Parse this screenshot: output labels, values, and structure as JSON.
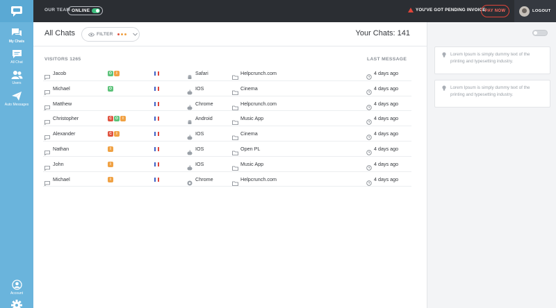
{
  "topbar": {
    "team_label": "OUR TEAM",
    "status": "ONLINE",
    "warning": "YOU'VE GOT PENDING INVOICE",
    "pay_now": "PAY NOW",
    "logout": "LOGOUT",
    "colors": {
      "bg": "#2b2e33",
      "accent": "#e0453a",
      "online": "#3fbf7f"
    }
  },
  "sidebar": {
    "color": "#6ab4dc",
    "items": [
      {
        "label": "My Chats",
        "icon": "chats-icon",
        "active": true
      },
      {
        "label": "All Chat",
        "icon": "chat-bubble-icon",
        "active": false
      },
      {
        "label": "Users",
        "icon": "users-icon",
        "active": false
      },
      {
        "label": "Auto Messages",
        "icon": "paper-plane-icon",
        "active": false
      }
    ],
    "bottom": [
      {
        "label": "Account",
        "icon": "account-icon"
      },
      {
        "label": "",
        "icon": "gear-icon"
      }
    ]
  },
  "main": {
    "title": "All Chats",
    "filter_label": "FILTER",
    "your_chats": "Your Chats: 141",
    "col_visitors": "VISITORS 1265",
    "col_last_message": "LAST MESSAGE"
  },
  "badge_colors": {
    "O": "#5cc279",
    "I": "#f0a143",
    "C": "#e0533f"
  },
  "flag_colors": [
    "#3d5fc4",
    "#ffffff",
    "#e0453a"
  ],
  "rows": [
    {
      "name": "Jacob",
      "badges": [
        "O",
        "I"
      ],
      "os": "Safari",
      "os_icon": "android-icon",
      "source": "Helpcrunch.com",
      "time": "4 days ago"
    },
    {
      "name": "Michael",
      "badges": [
        "O"
      ],
      "os": "IOS",
      "os_icon": "apple-icon",
      "source": "Cinema",
      "time": "4 days ago"
    },
    {
      "name": "Matthew",
      "badges": [],
      "os": "Chrome",
      "os_icon": "apple-icon",
      "source": "Helpcrunch.com",
      "time": "4 days ago"
    },
    {
      "name": "Christopher",
      "badges": [
        "C",
        "O",
        "I"
      ],
      "os": "Android",
      "os_icon": "android-icon",
      "source": "Music App",
      "time": "4 days ago"
    },
    {
      "name": "Alexander",
      "badges": [
        "C",
        "I"
      ],
      "os": "IOS",
      "os_icon": "apple-icon",
      "source": "Cinema",
      "time": "4 days ago"
    },
    {
      "name": "Nathan",
      "badges": [
        "I"
      ],
      "os": "IOS",
      "os_icon": "apple-icon",
      "source": "Open PL",
      "time": "4 days ago"
    },
    {
      "name": "John",
      "badges": [
        "I"
      ],
      "os": "IOS",
      "os_icon": "apple-icon",
      "source": "Music App",
      "time": "4 days ago"
    },
    {
      "name": "Michael",
      "badges": [
        "I"
      ],
      "os": "Chrome",
      "os_icon": "chrome-icon",
      "source": "Helpcrunch.com",
      "time": "4 days ago"
    }
  ],
  "right_panel": {
    "notes": [
      "Lorem Ipsum is simply dummy text of the printing and typesetting industry.",
      "Lorem Ipsum is simply dummy text of the printing and typesetting industry."
    ]
  }
}
